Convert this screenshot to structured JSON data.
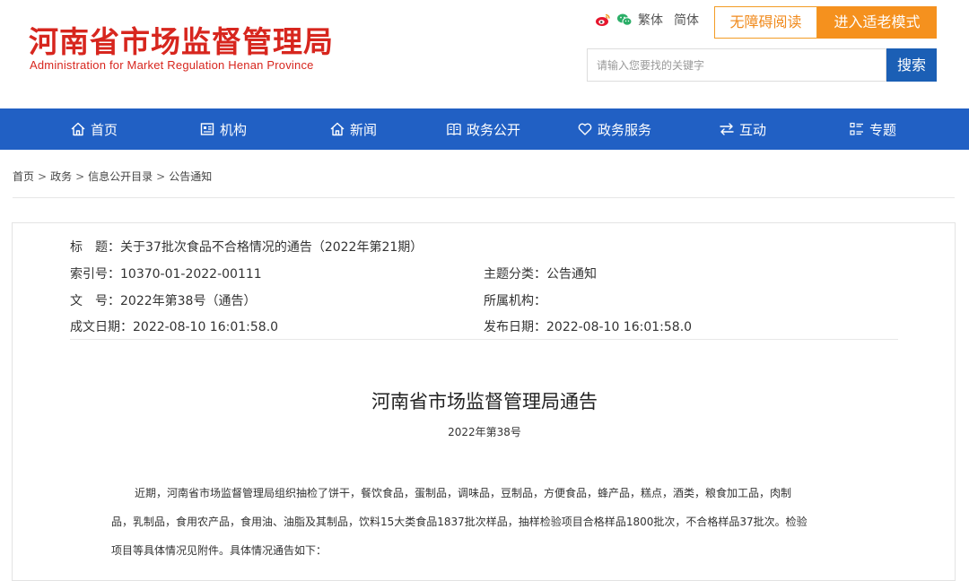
{
  "header": {
    "logo_cn": "河南省市场监督管理局",
    "logo_en": "Administration for Market Regulation Henan Province",
    "links": {
      "traditional": "繁体",
      "simplified": "简体"
    },
    "accessibility_label": "无障碍阅读",
    "elder_mode_label": "进入适老模式",
    "search": {
      "placeholder": "请输入您要找的关键字",
      "button_label": "搜索"
    }
  },
  "nav": {
    "items": [
      {
        "label": "首页",
        "icon": "home-icon"
      },
      {
        "label": "机构",
        "icon": "organization-icon"
      },
      {
        "label": "新闻",
        "icon": "news-icon"
      },
      {
        "label": "政务公开",
        "icon": "book-icon"
      },
      {
        "label": "政务服务",
        "icon": "heart-icon"
      },
      {
        "label": "互动",
        "icon": "exchange-icon"
      },
      {
        "label": "专题",
        "icon": "list-icon"
      }
    ]
  },
  "breadcrumb": {
    "items": [
      "首页",
      "政务",
      "信息公开目录",
      "公告通知"
    ],
    "separator": ">"
  },
  "meta": {
    "title_label": "标　题：",
    "title_value": "关于37批次食品不合格情况的通告（2022年第21期）",
    "index_label": "索引号：",
    "index_value": "10370-01-2022-00111",
    "category_label": "主题分类：",
    "category_value": "公告通知",
    "docno_label": "文　号：",
    "docno_value": "2022年第38号（通告）",
    "org_label": "所属机构：",
    "org_value": "",
    "created_label": "成文日期：",
    "created_value": "2022-08-10 16:01:58.0",
    "published_label": "发布日期：",
    "published_value": "2022-08-10 16:01:58.0"
  },
  "document": {
    "heading": "河南省市场监督管理局通告",
    "number": "2022年第38号",
    "paragraph_lines": [
      "近期，河南省市场监督管理局组织抽检了饼干，餐饮食品，蛋制品，调味品，豆制品，方便食品，蜂产品，糕点，酒类，粮食加工品，肉制",
      "品，乳制品，食用农产品，食用油、油脂及其制品，饮料15大类食品1837批次样品，抽样检验项目合格样品1800批次，不合格样品37批次。检验",
      "项目等具体情况见附件。具体情况通告如下："
    ]
  },
  "colors": {
    "brand_red": "#d7261e",
    "nav_blue": "#2160c4",
    "accent_orange": "#f5911e",
    "search_blue": "#1b5fb5"
  }
}
